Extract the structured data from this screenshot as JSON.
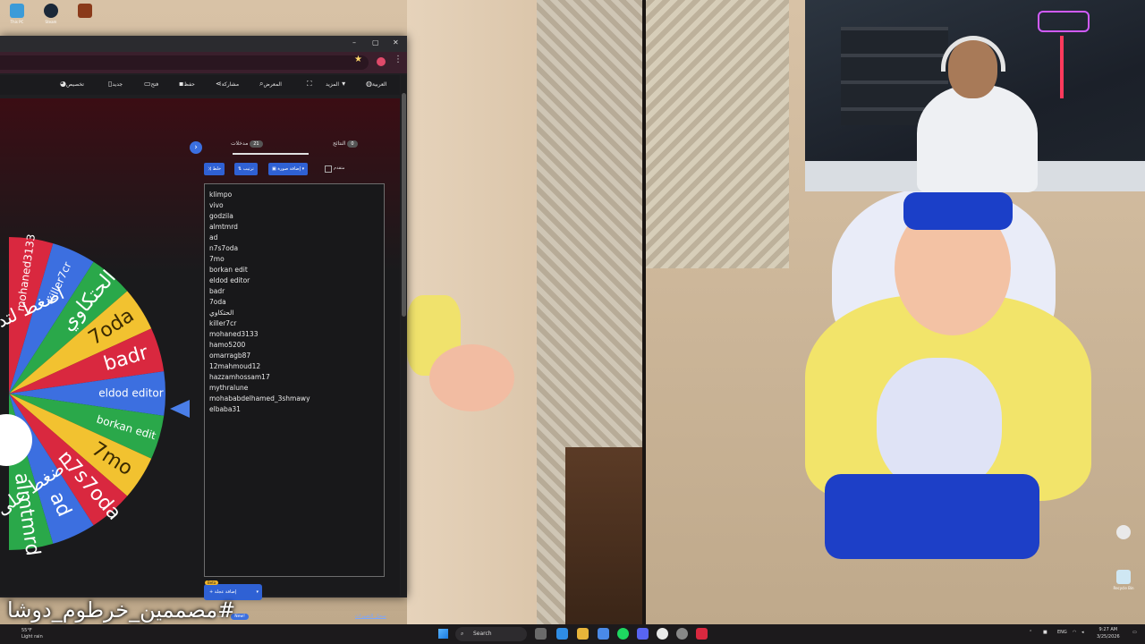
{
  "taskbar": {
    "search_placeholder": "Search",
    "weather_line1": "55°F",
    "weather_line2": "Light rain",
    "lang": "ENG",
    "time": "9:27 AM",
    "date": "3/25/2026"
  },
  "desktop_icons": {
    "this_pc": "This PC",
    "steam": "Steam",
    "recycle": "Recycle Bin"
  },
  "toolbar": {
    "customize": "تخصيص",
    "new": "جديد",
    "open": "فتح",
    "save": "حفظ",
    "share": "مشاركة",
    "gallery": "المعرض",
    "more": "المزيد",
    "language": "العربية"
  },
  "panel": {
    "tab_entries_label": "مدخلات",
    "tab_entries_count": "21",
    "tab_results_label": "النتائج",
    "tab_results_count": "0",
    "shuffle_label": "خلط",
    "sort_label": "ترتيب",
    "add_image_label": "إضافة صورة",
    "advanced_label": "متقدم",
    "add_wheel_label": "إضافة عجلة",
    "beta": "Beta",
    "version_label": "الإصدار 405",
    "new_badge": "New!",
    "changelog": "سجل التغييرات"
  },
  "entries": [
    "klimpo",
    "vivo",
    "godzila",
    "almtmrd",
    "ad",
    "n7s7oda",
    "7mo",
    "borkan edit",
    "eldod editor",
    "badr",
    "7oda",
    "الحتكاوي",
    "killer7cr",
    "mohaned3133",
    "hamo5200",
    "omarragb87",
    "12mahmoud12",
    "hazzamhossam17",
    "mythralune",
    "mohababdelhamed_3shmawy",
    "elbaba31"
  ],
  "wheel": {
    "segments": [
      {
        "label": "mohaned3133",
        "color": "#d9283f"
      },
      {
        "label": "killer7cr",
        "color": "#3c6fe0"
      },
      {
        "label": "الحتكاوي",
        "color": "#2aa84a"
      },
      {
        "label": "7oda",
        "color": "#f2c230"
      },
      {
        "label": "badr",
        "color": "#d9283f"
      },
      {
        "label": "eldod editor",
        "color": "#3c6fe0"
      },
      {
        "label": "borkan edit",
        "color": "#2aa84a"
      },
      {
        "label": "7mo",
        "color": "#f2c230"
      },
      {
        "label": "n7s7oda",
        "color": "#d9283f"
      },
      {
        "label": "ad",
        "color": "#3c6fe0"
      },
      {
        "label": "almtmrd",
        "color": "#2aa84a"
      }
    ],
    "overlay_text_top": "اضغط لتدوير",
    "overlay_text_bottom": "اضغط على"
  },
  "hashtag": "#مصممين_خرطوم_دوشا"
}
